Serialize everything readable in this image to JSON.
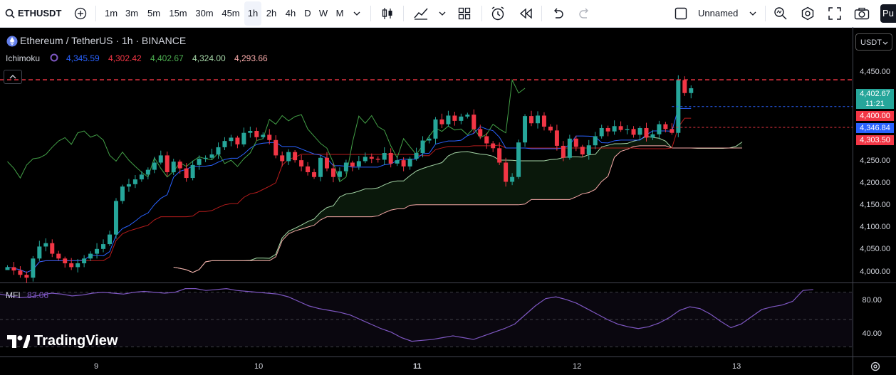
{
  "toolbar": {
    "symbol": "ETHUSDT",
    "intervals": [
      "1m",
      "3m",
      "5m",
      "15m",
      "30m",
      "45m",
      "1h",
      "2h",
      "4h",
      "D",
      "W",
      "M"
    ],
    "selected_interval": "1h",
    "layout_name": "Unnamed",
    "publish_label": "Pu"
  },
  "legend": {
    "title": "Ethereum / TetherUS · 1h · BINANCE",
    "indicator": "Ichimoku",
    "values": [
      {
        "text": "4,345.59",
        "color": "#2962ff"
      },
      {
        "text": "4,302.42",
        "color": "#f23645"
      },
      {
        "text": "4,402.67",
        "color": "#4caf50"
      },
      {
        "text": "4,324.00",
        "color": "#a5d6a7"
      },
      {
        "text": "4,293.66",
        "color": "#f7a9a8"
      }
    ]
  },
  "unit_selector": "USDT",
  "mfi": {
    "label": "MFI",
    "value": "83.06",
    "ticks": [
      "80.00",
      "40.00"
    ]
  },
  "price_badges": [
    {
      "text": "4,402.67",
      "sub": "11:21",
      "color": "#26a69a"
    },
    {
      "text": "4,400.00",
      "color": "#f23645"
    },
    {
      "text": "4,346.84",
      "color": "#2962ff"
    },
    {
      "text": "4,303.50",
      "color": "#f23645"
    }
  ],
  "watermark": "TradingView",
  "colors": {
    "up": "#26a69a",
    "down": "#f23645",
    "tenkan": "#2962ff",
    "kijun": "#b71c1c",
    "chikou": "#43a047",
    "spanA": "#a5d6a7",
    "spanB": "#f7a9a8",
    "mfi": "#7e57c2"
  },
  "chart_data": {
    "type": "candlestick",
    "title": "Ethereum / TetherUS · 1h · BINANCE",
    "y_ticks": [
      "4,450.00",
      "4,400.00",
      "4,350.00",
      "4,300.00",
      "4,250.00",
      "4,200.00",
      "4,150.00",
      "4,100.00",
      "4,050.00",
      "4,000.00"
    ],
    "ylim": [
      3980,
      4480
    ],
    "x_ticks": [
      "9",
      "10",
      "11",
      "12",
      "13"
    ],
    "last_price": 4402.67,
    "close_series": [
      4012,
      4005,
      3996,
      3990,
      4030,
      4055,
      4062,
      4040,
      4030,
      4020,
      4012,
      4020,
      4030,
      4040,
      4050,
      4060,
      4080,
      4150,
      4180,
      4185,
      4195,
      4205,
      4215,
      4230,
      4245,
      4210,
      4232,
      4218,
      4198,
      4225,
      4238,
      4240,
      4247,
      4262,
      4275,
      4282,
      4268,
      4292,
      4296,
      4283,
      4288,
      4277,
      4245,
      4233,
      4252,
      4235,
      4222,
      4210,
      4200,
      4240,
      4218,
      4200,
      4212,
      4230,
      4222,
      4233,
      4242,
      4238,
      4236,
      4250,
      4228,
      4235,
      4222,
      4238,
      4250,
      4276,
      4280,
      4320,
      4310,
      4328,
      4317,
      4326,
      4330,
      4300,
      4285,
      4270,
      4260,
      4230,
      4190,
      4200,
      4272,
      4327,
      4312,
      4328,
      4305,
      4297,
      4265,
      4240,
      4280,
      4263,
      4247,
      4266,
      4285,
      4302,
      4295,
      4306,
      4298,
      4300,
      4288,
      4302,
      4282,
      4289,
      4310,
      4300,
      4292,
      4402,
      4375,
      4385
    ],
    "mfi_values": [
      78,
      76,
      74,
      75,
      77,
      79,
      78,
      76,
      77,
      79,
      80,
      79,
      78,
      80,
      81,
      80,
      79,
      80,
      84,
      84,
      82,
      83,
      84,
      82,
      81,
      80,
      79,
      78,
      75,
      70,
      65,
      62,
      60,
      58,
      55,
      50,
      45,
      40,
      36,
      30,
      26,
      27,
      28,
      30,
      32,
      30,
      28,
      32,
      36,
      40,
      45,
      55,
      65,
      73,
      75,
      72,
      68,
      62,
      56,
      50,
      45,
      42,
      40,
      42,
      46,
      52,
      60,
      64,
      62,
      56,
      48,
      41,
      45,
      53,
      61,
      64,
      66,
      70,
      82,
      83
    ]
  }
}
